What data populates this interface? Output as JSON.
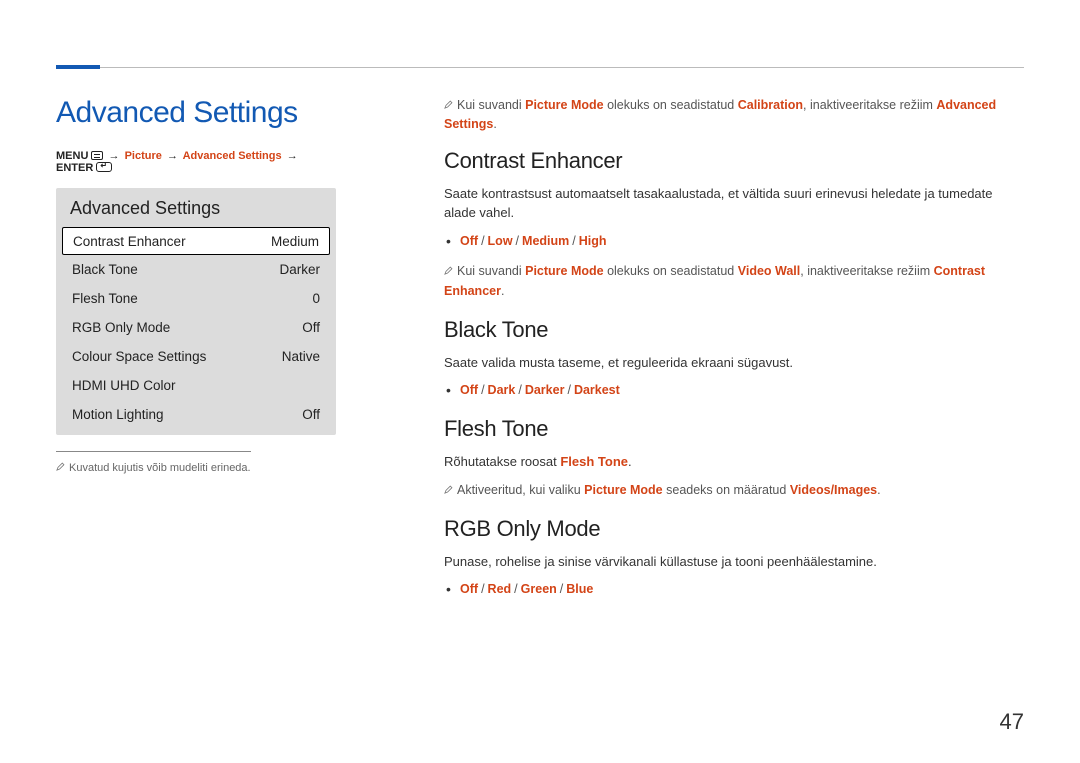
{
  "page_number": "47",
  "heading": "Advanced Settings",
  "breadcrumb": {
    "menu_label": "MENU",
    "picture": "Picture",
    "advanced": "Advanced Settings",
    "enter_label": "ENTER"
  },
  "panel": {
    "title": "Advanced Settings",
    "rows": [
      {
        "label": "Contrast Enhancer",
        "value": "Medium",
        "selected": true
      },
      {
        "label": "Black Tone",
        "value": "Darker"
      },
      {
        "label": "Flesh Tone",
        "value": "0"
      },
      {
        "label": "RGB Only Mode",
        "value": "Off"
      },
      {
        "label": "Colour Space Settings",
        "value": "Native"
      },
      {
        "label": "HDMI UHD Color",
        "value": ""
      },
      {
        "label": "Motion Lighting",
        "value": "Off"
      }
    ]
  },
  "footnote": "Kuvatud kujutis võib mudeliti erineda.",
  "top_note": {
    "p1": "Kui suvandi ",
    "red1": "Picture Mode",
    "p2": " olekuks on seadistatud ",
    "red2": "Calibration",
    "p3": ", inaktiveeritakse režiim ",
    "red3": "Advanced Settings",
    "p4": "."
  },
  "sections": {
    "contrast": {
      "title": "Contrast Enhancer",
      "desc": "Saate kontrastsust automaatselt tasakaalustada, et vältida suuri erinevusi heledate ja tumedate alade vahel.",
      "opts": [
        "Off",
        "Low",
        "Medium",
        "High"
      ],
      "note": {
        "p1": "Kui suvandi ",
        "red1": "Picture Mode",
        "p2": " olekuks on seadistatud ",
        "red2": "Video Wall",
        "p3": ", inaktiveeritakse režiim ",
        "red3": "Contrast Enhancer",
        "p4": "."
      }
    },
    "blacktone": {
      "title": "Black Tone",
      "desc": "Saate valida musta taseme, et reguleerida ekraani sügavust.",
      "opts": [
        "Off",
        "Dark",
        "Darker",
        "Darkest"
      ]
    },
    "fleshtone": {
      "title": "Flesh Tone",
      "desc_p1": "Rõhutatakse roosat ",
      "desc_red": "Flesh Tone",
      "desc_p2": ".",
      "note": {
        "p1": "Aktiveeritud, kui valiku ",
        "red1": "Picture Mode",
        "p2": " seadeks on määratud ",
        "red2": "Videos/Images",
        "p3": "."
      }
    },
    "rgb": {
      "title": "RGB Only Mode",
      "desc": "Punase, rohelise ja sinise värvikanali küllastuse ja tooni peenhäälestamine.",
      "opts": [
        "Off",
        "Red",
        "Green",
        "Blue"
      ]
    }
  }
}
